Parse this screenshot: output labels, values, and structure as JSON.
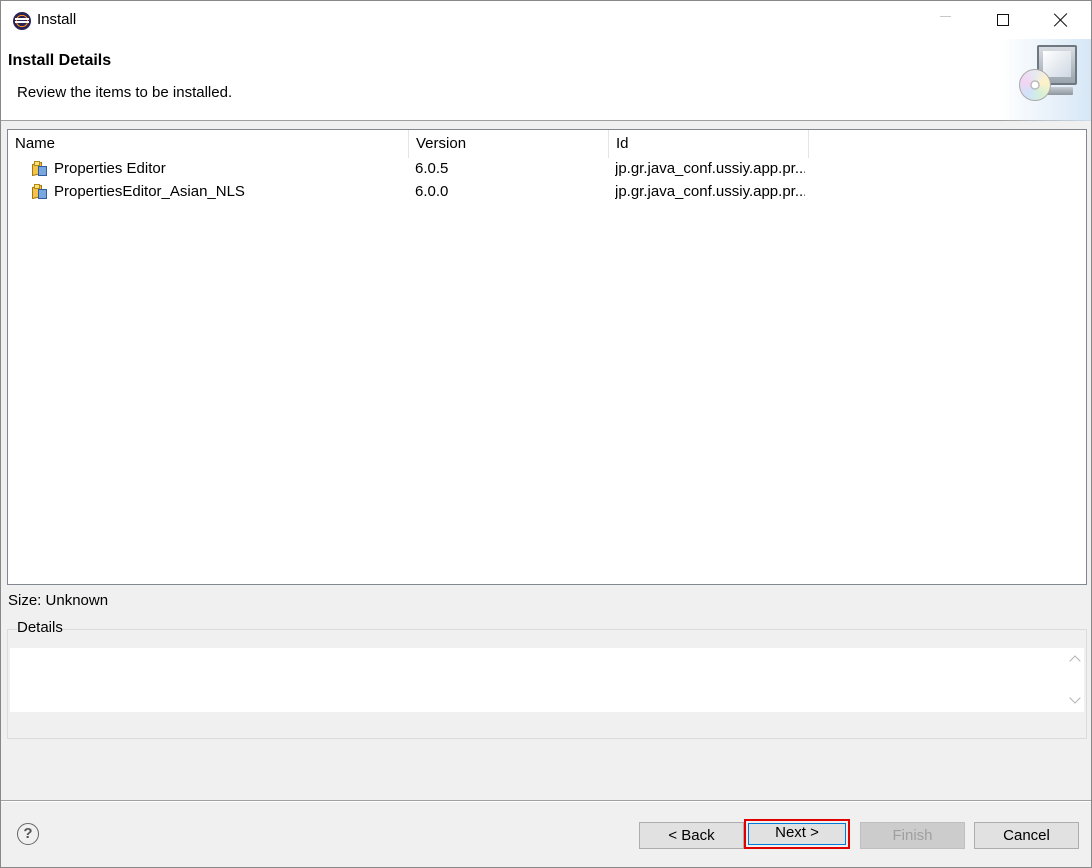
{
  "window": {
    "title": "Install",
    "controls": {
      "minimize": "minimize-icon",
      "maximize": "maximize-icon",
      "close": "close-icon"
    }
  },
  "header": {
    "title": "Install Details",
    "description": "Review the items to be installed."
  },
  "table": {
    "columns": [
      "Name",
      "Version",
      "Id"
    ],
    "rows": [
      {
        "name": "Properties Editor",
        "version": "6.0.5",
        "id": "jp.gr.java_conf.ussiy.app.pr..."
      },
      {
        "name": "PropertiesEditor_Asian_NLS",
        "version": "6.0.0",
        "id": "jp.gr.java_conf.ussiy.app.pr..."
      }
    ]
  },
  "size_label": "Size: Unknown",
  "details": {
    "label": "Details",
    "text": ""
  },
  "footer": {
    "help": "?",
    "back_label": "< Back",
    "next_label": "Next >",
    "finish_label": "Finish",
    "cancel_label": "Cancel"
  },
  "colors": {
    "highlight": "#e00000",
    "focus": "#0078d7"
  }
}
